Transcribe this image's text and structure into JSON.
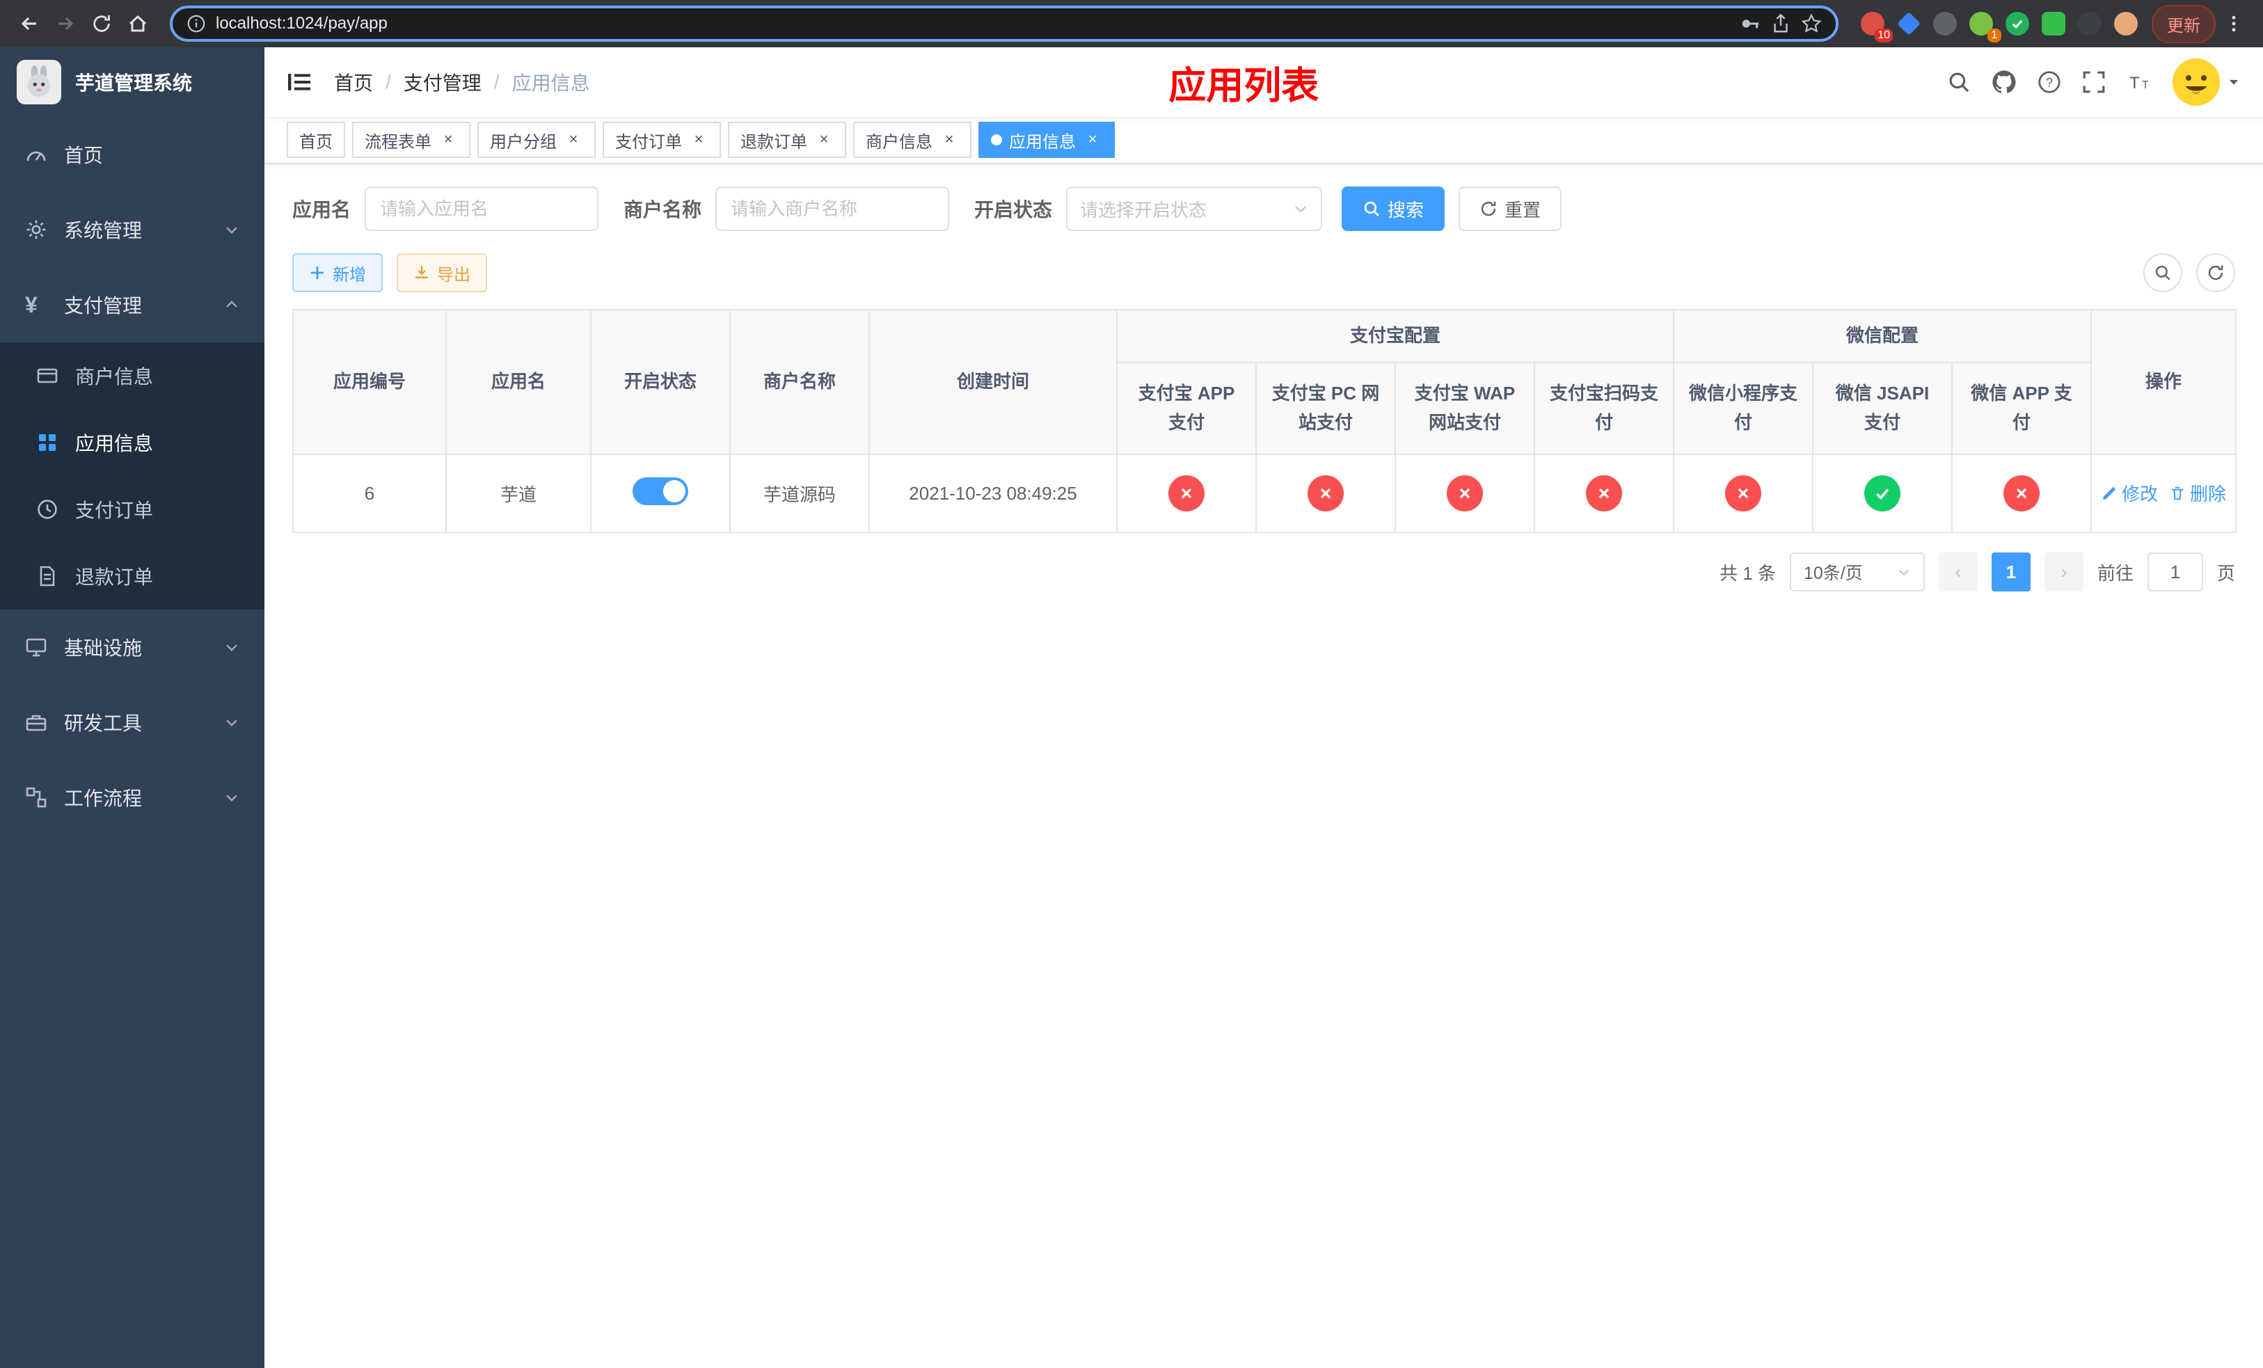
{
  "theme": {
    "primary": "#409eff",
    "success": "#13ce66",
    "danger": "#f85050",
    "warning": "#e6a23c",
    "sidebar_bg": "#304156",
    "submenu_bg": "#1f2d3d",
    "title_red": "#ff0000"
  },
  "browser": {
    "url": "localhost:1024/pay/app",
    "update_label": "更新",
    "ext_badge_1": "10",
    "ext_badge_2": "1"
  },
  "sidebar": {
    "logo_title": "芋道管理系统",
    "items": [
      {
        "label": "首页"
      },
      {
        "label": "系统管理"
      },
      {
        "label": "支付管理",
        "children": [
          {
            "label": "商户信息"
          },
          {
            "label": "应用信息"
          },
          {
            "label": "支付订单"
          },
          {
            "label": "退款订单"
          }
        ]
      },
      {
        "label": "基础设施"
      },
      {
        "label": "研发工具"
      },
      {
        "label": "工作流程"
      }
    ]
  },
  "header": {
    "breadcrumb": [
      "首页",
      "支付管理",
      "应用信息"
    ],
    "page_title": "应用列表"
  },
  "tags": [
    {
      "label": "首页"
    },
    {
      "label": "流程表单"
    },
    {
      "label": "用户分组"
    },
    {
      "label": "支付订单"
    },
    {
      "label": "退款订单"
    },
    {
      "label": "商户信息"
    },
    {
      "label": "应用信息"
    }
  ],
  "filters": {
    "app_name_label": "应用名",
    "app_name_placeholder": "请输入应用名",
    "merchant_name_label": "商户名称",
    "merchant_name_placeholder": "请输入商户名称",
    "status_label": "开启状态",
    "status_placeholder": "请选择开启状态",
    "search_label": "搜索",
    "reset_label": "重置"
  },
  "toolbar": {
    "add_label": "新增",
    "export_label": "导出"
  },
  "table": {
    "headers": {
      "app_id": "应用编号",
      "app_name": "应用名",
      "status": "开启状态",
      "merchant": "商户名称",
      "created": "创建时间",
      "alipay_group": "支付宝配置",
      "wechat_group": "微信配置",
      "actions": "操作"
    },
    "sub_headers": [
      "支付宝 APP 支付",
      "支付宝 PC 网站支付",
      "支付宝 WAP 网站支付",
      "支付宝扫码支付",
      "微信小程序支付",
      "微信 JSAPI 支付",
      "微信 APP 支付"
    ],
    "rows": [
      {
        "app_id": "6",
        "app_name": "芋道",
        "enabled": true,
        "merchant": "芋道源码",
        "created": "2021-10-23 08:49:25",
        "pay_configs": [
          false,
          false,
          false,
          false,
          false,
          true,
          false
        ],
        "edit_label": "修改",
        "delete_label": "删除"
      }
    ]
  },
  "pagination": {
    "total_text": "共 1 条",
    "page_size": "10条/页",
    "current_page": "1",
    "goto_prefix": "前往",
    "goto_value": "1",
    "goto_suffix": "页"
  }
}
